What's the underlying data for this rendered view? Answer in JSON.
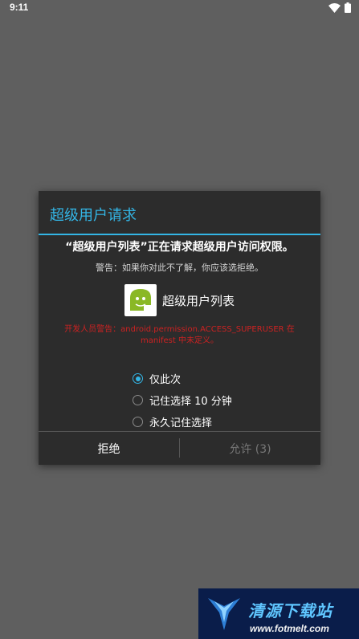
{
  "status_bar": {
    "time": "9:11",
    "icons": [
      "wifi-icon",
      "battery-icon"
    ]
  },
  "dialog": {
    "title": "超级用户请求",
    "request_message": "“超级用户列表”正在请求超级用户访问权限。",
    "warning": "警告：如果你对此不了解，你应该选拒绝。",
    "app_name": "超级用户列表",
    "developer_warning": "开发人员警告：android.permission.ACCESS_SUPERUSER 在 manifest 中未定义。",
    "options": [
      {
        "label": "仅此次",
        "checked": true
      },
      {
        "label": "记住选择 10 分钟",
        "checked": false
      },
      {
        "label": "永久记住选择",
        "checked": false
      }
    ],
    "buttons": {
      "deny": "拒绝",
      "allow": "允许 (3)"
    }
  },
  "watermark": {
    "title": "清源下载站",
    "url": "www.fotmelt.com"
  },
  "colors": {
    "accent": "#33b5e5",
    "dialog_bg": "#2c2c2c",
    "backdrop": "#5f5f5f",
    "warning_red": "#cc2222"
  }
}
